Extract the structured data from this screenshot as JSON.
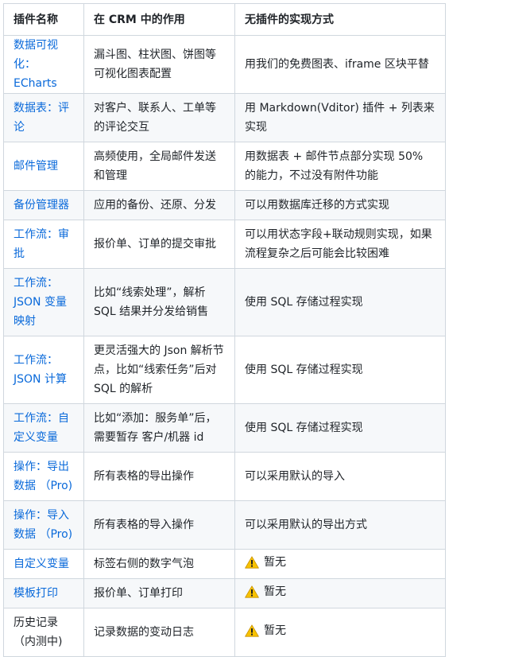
{
  "headers": [
    "插件名称",
    "在 CRM 中的作用",
    "无插件的实现方式"
  ],
  "rows": [
    {
      "name": "数据可视化：ECharts",
      "role": "漏斗图、柱状图、饼图等可视化图表配置",
      "alt": "用我们的免费图表、iframe 区块平替",
      "warn": false,
      "h": 62
    },
    {
      "name": "数据表：评论",
      "role": "对客户、联系人、工单等的评论交互",
      "alt": "用 Markdown(Vditor) 插件 + 列表来实现",
      "warn": false,
      "h": 61
    },
    {
      "name": "邮件管理",
      "role": "高频使用，全局邮件发送和管理",
      "alt": "用数据表 + 邮件节点部分实现 50% 的能力，不过没有附件功能",
      "warn": false,
      "h": 61
    },
    {
      "name": "备份管理器",
      "role": "应用的备份、还原、分发",
      "alt": "可以用数据库迁移的方式实现",
      "warn": false,
      "h": 37
    },
    {
      "name": "工作流：审批",
      "role": "报价单、订单的提交审批",
      "alt": "可以用状态字段+联动规则实现，如果流程复杂之后可能会比较困难",
      "warn": false,
      "h": 61
    },
    {
      "name": "工作流：JSON 变量映射",
      "role": "比如“线索处理”，解析 SQL 结果并分发给销售",
      "alt": "使用 SQL 存储过程实现",
      "warn": false,
      "h": 85
    },
    {
      "name": "工作流：JSON 计算",
      "role": "更灵活强大的 Json 解析节点，比如“线索任务”后对 SQL 的解析",
      "alt": "使用 SQL 存储过程实现",
      "warn": false,
      "h": 85
    },
    {
      "name": "工作流：自定义变量",
      "role": "比如“添加：服务单”后，需要暂存 客户/机器 id",
      "alt": "使用 SQL 存储过程实现",
      "warn": false,
      "h": 61
    },
    {
      "name": "操作：导出数据 （Pro)",
      "role": "所有表格的导出操作",
      "alt": "可以采用默认的导入",
      "warn": false,
      "h": 61
    },
    {
      "name": "操作：导入数据 （Pro)",
      "role": "所有表格的导入操作",
      "alt": "可以采用默认的导出方式",
      "warn": false,
      "h": 61
    },
    {
      "name": "自定义变量",
      "role": "标签右侧的数字气泡",
      "alt": "暂无",
      "warn": true,
      "h": 37
    },
    {
      "name": "模板打印",
      "role": "报价单、订单打印",
      "alt": "暂无",
      "warn": true,
      "h": 37
    },
    {
      "name": "历史记录（内测中)",
      "role": "记录数据的变动日志",
      "alt": "暂无",
      "warn": true,
      "h": 61
    }
  ],
  "link_color": "#0969da",
  "warn_icon": "warning-icon"
}
